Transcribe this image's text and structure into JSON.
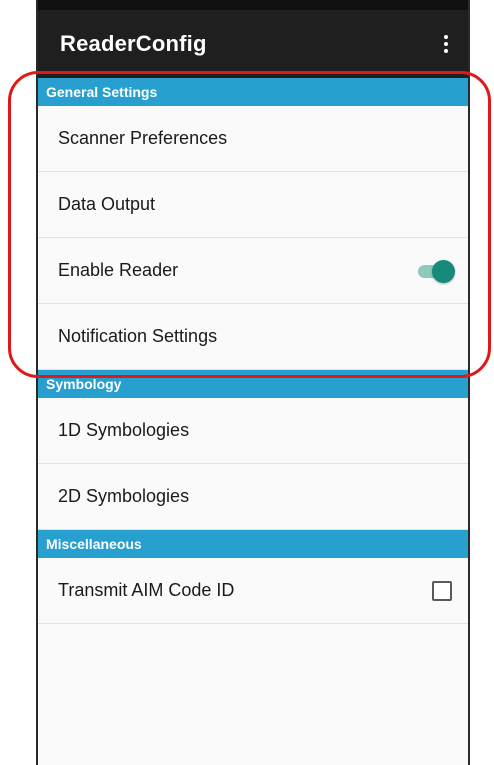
{
  "app": {
    "title": "ReaderConfig",
    "menu_icon": "more-vert-icon"
  },
  "sections": [
    {
      "header": "General Settings",
      "items": [
        {
          "label": "Scanner Preferences"
        },
        {
          "label": "Data Output"
        },
        {
          "label": "Enable Reader",
          "control": "toggle",
          "on": true
        },
        {
          "label": "Notification Settings"
        }
      ]
    },
    {
      "header": "Symbology",
      "items": [
        {
          "label": "1D Symbologies"
        },
        {
          "label": "2D Symbologies"
        }
      ]
    },
    {
      "header": "Miscellaneous",
      "items": [
        {
          "label": "Transmit AIM Code ID",
          "control": "checkbox",
          "checked": false
        }
      ]
    }
  ],
  "colors": {
    "app_bar": "#1f1f1f",
    "section_header": "#27a0cf",
    "toggle_on": "#168a7b",
    "highlight": "#e01818"
  }
}
